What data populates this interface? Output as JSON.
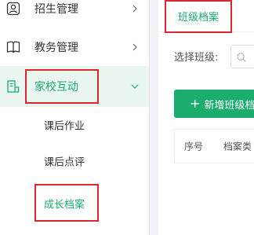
{
  "sidebar": {
    "items": [
      {
        "label": "招生管理",
        "icon": "user-icon"
      },
      {
        "label": "教务管理",
        "icon": "book-icon"
      },
      {
        "label": "家校互动",
        "icon": "home-school-icon"
      }
    ],
    "sub_items": [
      {
        "label": "课后作业"
      },
      {
        "label": "课后点评"
      },
      {
        "label": "成长档案"
      }
    ]
  },
  "main": {
    "tab_label": "班级档案",
    "filter_label": "选择班级:",
    "add_button": {
      "plus": "+",
      "label": "新增班级档"
    },
    "table": {
      "headers": [
        "序号",
        "档案类"
      ]
    }
  },
  "colors": {
    "accent": "#1aad6e",
    "active_bg": "#e9f6f0",
    "annotation": "#d9272e"
  }
}
